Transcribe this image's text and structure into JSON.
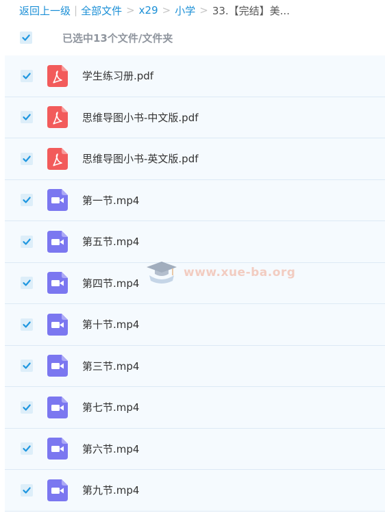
{
  "breadcrumb": {
    "back": "返回上一级",
    "pipe": "|",
    "all_files": "全部文件",
    "sep": ">",
    "x29": "x29",
    "primary": "小学",
    "current": "33.【完结】美..."
  },
  "selection": {
    "text": "已选中13个文件/文件夹",
    "checked": true
  },
  "files": [
    {
      "name": "学生练习册.pdf",
      "type": "pdf",
      "icon": "pdf-file-icon",
      "checked": true
    },
    {
      "name": "思维导图小书-中文版.pdf",
      "type": "pdf",
      "icon": "pdf-file-icon",
      "checked": true
    },
    {
      "name": "思维导图小书-英文版.pdf",
      "type": "pdf",
      "icon": "pdf-file-icon",
      "checked": true
    },
    {
      "name": "第一节.mp4",
      "type": "video",
      "icon": "video-file-icon",
      "checked": true
    },
    {
      "name": "第五节.mp4",
      "type": "video",
      "icon": "video-file-icon",
      "checked": true
    },
    {
      "name": "第四节.mp4",
      "type": "video",
      "icon": "video-file-icon",
      "checked": true
    },
    {
      "name": "第十节.mp4",
      "type": "video",
      "icon": "video-file-icon",
      "checked": true
    },
    {
      "name": "第三节.mp4",
      "type": "video",
      "icon": "video-file-icon",
      "checked": true
    },
    {
      "name": "第七节.mp4",
      "type": "video",
      "icon": "video-file-icon",
      "checked": true
    },
    {
      "name": "第六节.mp4",
      "type": "video",
      "icon": "video-file-icon",
      "checked": true
    },
    {
      "name": "第九节.mp4",
      "type": "video",
      "icon": "video-file-icon",
      "checked": true
    }
  ],
  "watermark": {
    "text": "www.xue-ba.org"
  },
  "colors": {
    "link": "#1b8fd6",
    "check": "#1f97e0",
    "pdf": "#f25b5b",
    "video": "#7b77f0",
    "row_bg": "#f5fafe",
    "row_border": "#dce9f5"
  }
}
